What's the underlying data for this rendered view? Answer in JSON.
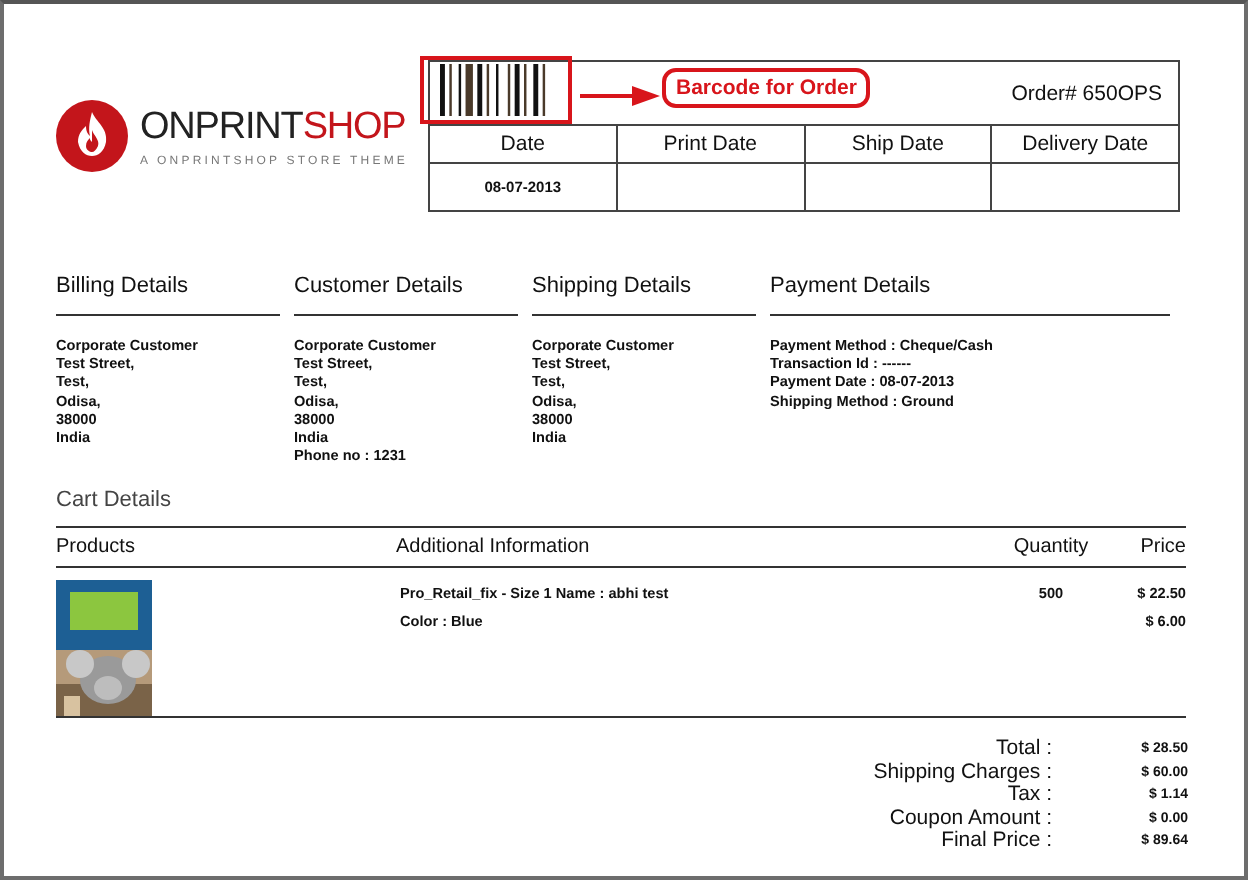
{
  "header": {
    "brand": [
      "ONPRINT",
      "SHOP"
    ],
    "tagline": "A  ONPRINTSHOP  STORE THEME",
    "order_number": "Order# 650OPS",
    "annotation": "Barcode for Order",
    "columns": [
      "Date",
      "Print Date",
      "Ship Date",
      "Delivery Date"
    ],
    "values": [
      "08-07-2013"
    ]
  },
  "details": [
    {
      "title": "Billing Details",
      "lines": [
        "Corporate Customer",
        "Test Street,",
        "Test,",
        "Odisa,",
        "38000",
        "India"
      ]
    },
    {
      "title": "Customer Details",
      "lines": [
        "Corporate Customer",
        "Test Street,",
        "Test,",
        "Odisa,",
        "38000",
        "India",
        "Phone no : 1231"
      ]
    },
    {
      "title": "Shipping Details",
      "lines": [
        "Corporate Customer",
        "Test Street,",
        "Test,",
        "Odisa,",
        "38000",
        "India"
      ]
    },
    {
      "title": "Payment Details",
      "lines": [
        "Payment Method : Cheque/Cash",
        "Transaction Id : ------",
        "Payment Date : 08-07-2013",
        "Shipping Method : Ground"
      ]
    }
  ],
  "cart": {
    "title": "Cart Details",
    "columns": [
      "Products",
      "Additional Information",
      "Quantity",
      "Price"
    ],
    "items": [
      {
        "kind": "picture",
        "info": [
          "Pro_Retail_fix - Size 1 Name : abhi test",
          "Color : Blue"
        ],
        "quantity": "500",
        "prices": [
          "$ 22.50",
          "$ 6.00"
        ]
      }
    ]
  },
  "totals": [
    {
      "label": "Total :",
      "value": "$ 28.50"
    },
    {
      "label": "Shipping Charges :",
      "value": "$ 60.00"
    },
    {
      "label": "Tax :",
      "value": "$ 1.14"
    },
    {
      "label": "Coupon Amount :",
      "value": "$ 0.00"
    },
    {
      "label": "Final Price :",
      "value": "$ 89.64"
    }
  ]
}
